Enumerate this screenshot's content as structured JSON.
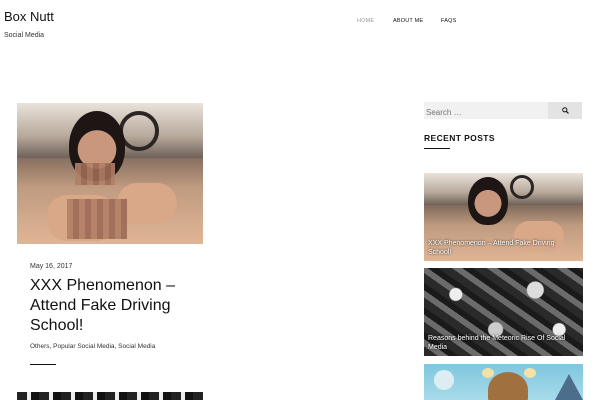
{
  "site": {
    "title": "Box Nutt",
    "tagline": "Social Media"
  },
  "nav": {
    "items": [
      "HOME",
      "ABOUT ME",
      "FAQS"
    ],
    "active": "HOME"
  },
  "post": {
    "date": "May 16, 2017",
    "title": "XXX Phenomenon – Attend Fake Driving School!",
    "categories": "Others, Popular Social Media, Social Media"
  },
  "sidebar": {
    "search": {
      "placeholder": "Search …"
    },
    "recent_posts_title": "RECENT POSTS",
    "recent": [
      {
        "title": "XXX Phenomenon – Attend Fake Driving School!"
      },
      {
        "title": "Reasons behind the Meteoric Rise Of Social Media"
      }
    ]
  },
  "icons": {
    "search": "search-icon"
  },
  "colors": {
    "text": "#111111",
    "nav_active": "#999999",
    "search_bg": "#f1f1f1"
  }
}
